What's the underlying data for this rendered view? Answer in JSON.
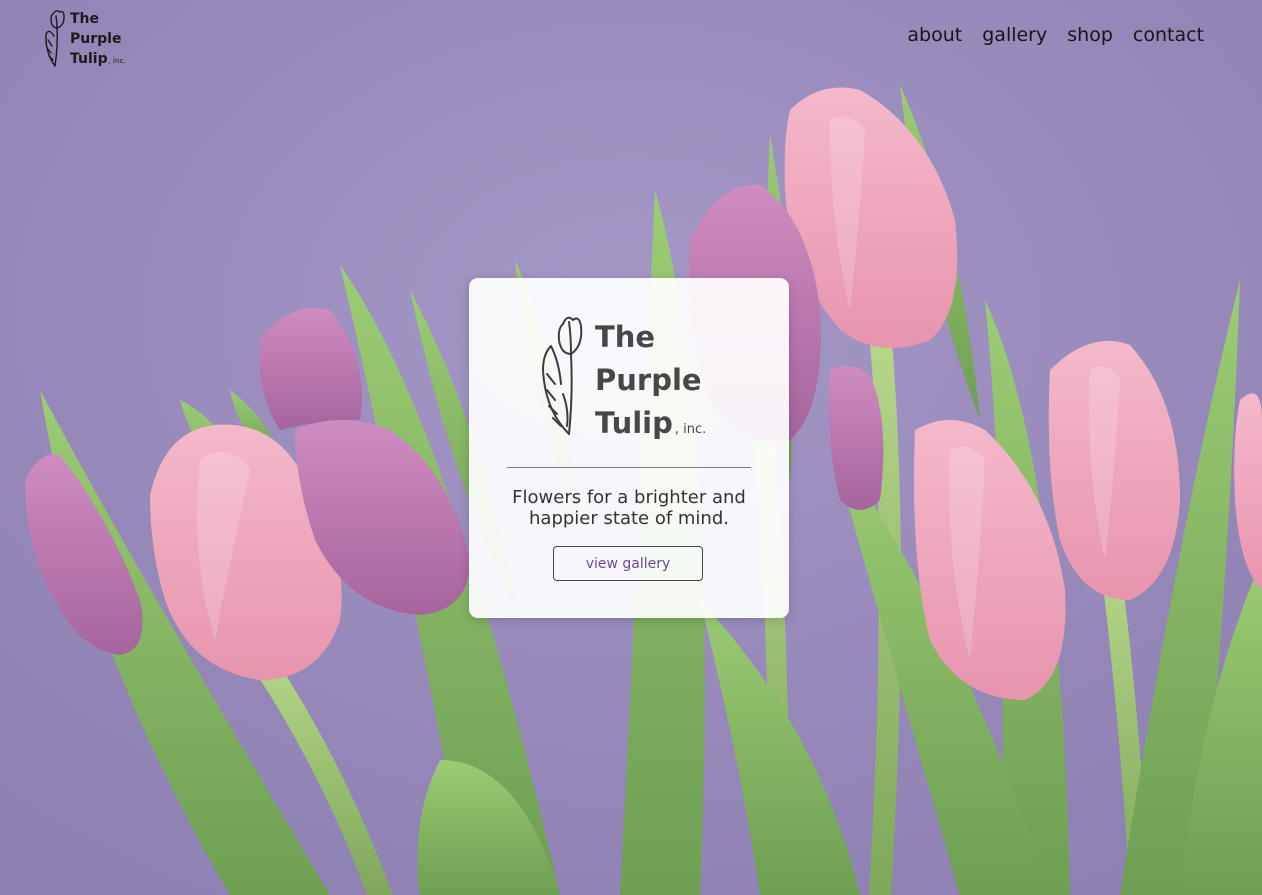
{
  "header": {
    "brand": {
      "line1": "The",
      "line2": "Purple",
      "line3": "Tulip",
      "suffix": ", inc."
    },
    "nav": [
      "about",
      "gallery",
      "shop",
      "contact"
    ]
  },
  "hero": {
    "card": {
      "name_line1": "The",
      "name_line2": "Purple",
      "name_line3": "Tulip",
      "name_suffix": ", inc.",
      "tagline": "Flowers for a brighter and happier state of mind.",
      "button_label": "view gallery"
    }
  },
  "colors": {
    "background_purple": "#9d90bf",
    "accent_text": "#6a4a9a",
    "tulip_pink": "#f1a8bf",
    "tulip_purple": "#c07fb0",
    "leaf_green": "#86b56a"
  },
  "icons": {
    "logo": "tulip-sketch-icon"
  }
}
